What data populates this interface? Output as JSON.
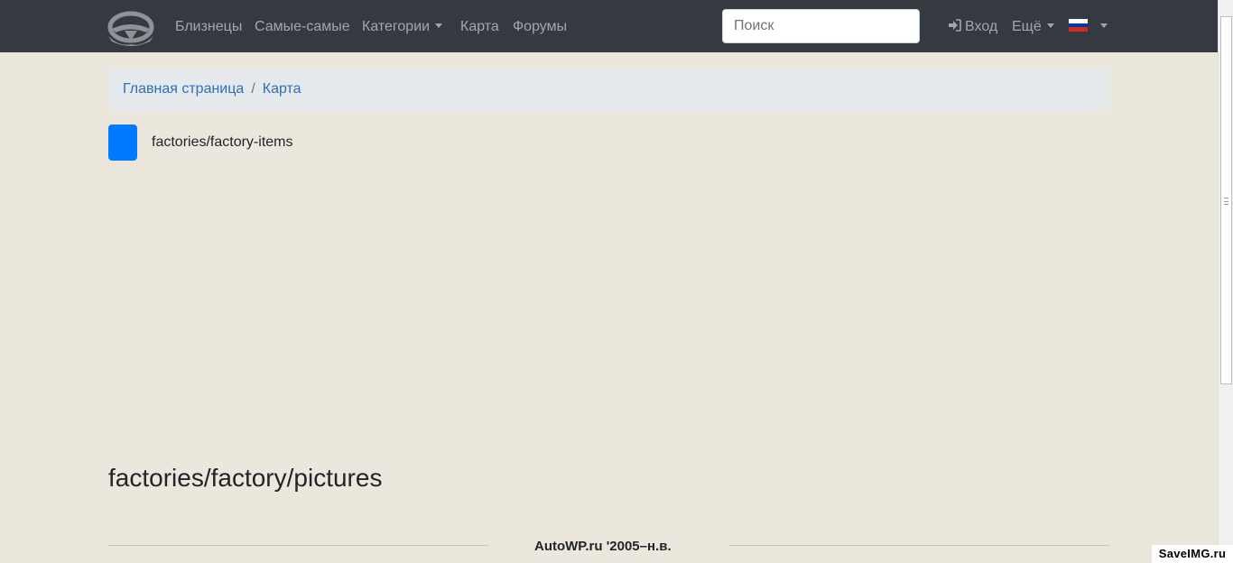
{
  "nav": {
    "logo_icon": "steering-wheel-logo",
    "links": [
      "Близнецы",
      "Самые-самые",
      "Категории",
      "Карта",
      "Форумы"
    ],
    "search_placeholder": "Поиск",
    "login_label": "Вход",
    "more_label": "Ещё",
    "language_flag": "russian-flag"
  },
  "breadcrumb": {
    "home": "Главная страница",
    "separator": "/",
    "current": "Карта"
  },
  "map_item": {
    "label": "factories/factory-items",
    "color": "#007bff"
  },
  "section_heading": "factories/factory/pictures",
  "footer": {
    "copyright": "AutoWP.ru '2005–н.в."
  },
  "watermark": "SaveIMG.ru",
  "colors": {
    "navbar_bg": "#343a40",
    "page_bg": "#ece7dc",
    "link": "#2c6fb7"
  }
}
